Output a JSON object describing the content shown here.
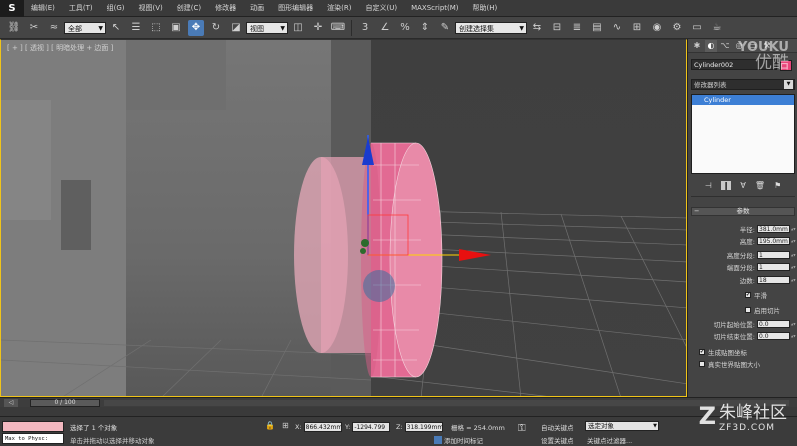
{
  "menubar": {
    "items": [
      "编辑(E)",
      "工具(T)",
      "组(G)",
      "视图(V)",
      "创建(C)",
      "修改器",
      "动画",
      "图形编辑器",
      "渲染(R)",
      "自定义(U)",
      "MAXScript(M)",
      "帮助(H)"
    ]
  },
  "toolbar": {
    "selection_filter": "全部",
    "ref_coord_system": "视图",
    "named_selection": "创建选择集"
  },
  "viewport": {
    "label": "[ + ] [ 透视 ] [ 明暗处理 + 边面 ]"
  },
  "command_panel": {
    "object_name": "Cylinder002",
    "object_color": "#e8457a",
    "modifier_list": "修改器列表",
    "stack": [
      "Cylinder"
    ],
    "rollout_title": "参数",
    "params": [
      {
        "label": "半径:",
        "value": "381.0mm"
      },
      {
        "label": "高度:",
        "value": "195.0mm"
      },
      {
        "label": "高度分段:",
        "value": "1"
      },
      {
        "label": "端面分段:",
        "value": "1"
      },
      {
        "label": "边数:",
        "value": "18"
      }
    ],
    "smooth": {
      "label": "平滑",
      "checked": true
    },
    "slice_on": {
      "label": "启用切片",
      "checked": false
    },
    "slice_from": {
      "label": "切片起始位置:",
      "value": "0.0"
    },
    "slice_to": {
      "label": "切片结束位置:",
      "value": "0.0"
    },
    "gen_map_coords": {
      "label": "生成贴图坐标",
      "checked": true
    },
    "real_world_map": {
      "label": "真实世界贴图大小",
      "checked": false
    }
  },
  "timeline": {
    "frame_display": "0 / 100"
  },
  "statusbar": {
    "script_text": "Max to Physc:",
    "selection_status": "选择了 1 个对象",
    "prompt": "单击并拖动以选择并移动对象",
    "x_value": "866.432mm",
    "y_value": "-1294.799",
    "z_value": "318.199mm",
    "grid": "栅格 = 254.0mm",
    "add_time_tag": "添加时间标记",
    "auto_key": "自动关键点",
    "set_key": "设置关键点",
    "selection_set": "选定对象",
    "key_filters": "关键点过滤器..."
  },
  "watermarks": {
    "youku_en": "YOUKU",
    "youku_cn": "优酷",
    "zf_logo": "Z",
    "zf_cn": "朱峰社区",
    "zf_url": "ZF3D.COM"
  }
}
